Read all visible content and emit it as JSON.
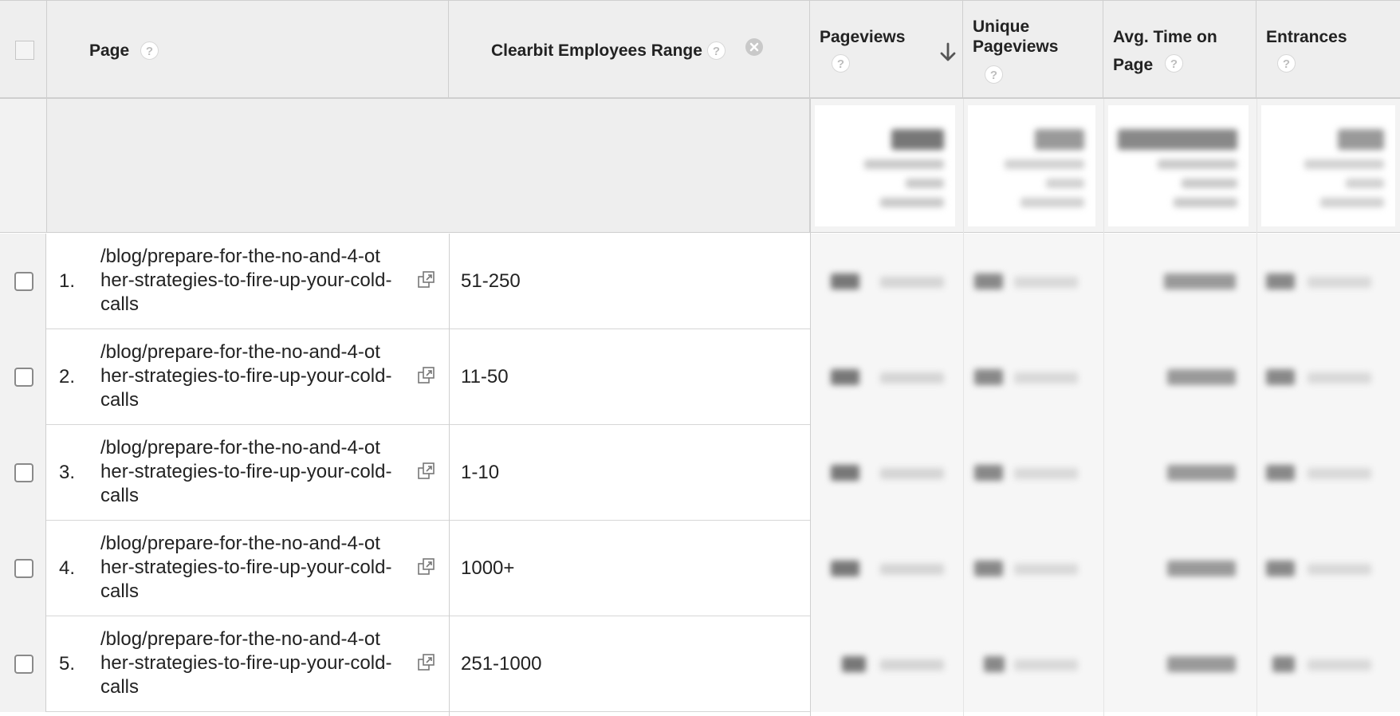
{
  "header": {
    "page_label": "Page",
    "clearbit_label": "Clearbit Employees Range",
    "pageviews_label": "Pageviews",
    "unique_line1": "Unique",
    "unique_line2": "Pageviews",
    "avgtime_line1": "Avg. Time on",
    "avgtime_line2": "Page",
    "entrances_label": "Entrances",
    "help_glyph": "?",
    "sort": "descending"
  },
  "rows": [
    {
      "num": "1.",
      "line1": "/blog/prepare-for-the-no-and-4-ot",
      "line2": "her-strategies-to-fire-up-your-cold-",
      "line3": "calls",
      "range": "51-250"
    },
    {
      "num": "2.",
      "line1": "/blog/prepare-for-the-no-and-4-ot",
      "line2": "her-strategies-to-fire-up-your-cold-",
      "line3": "calls",
      "range": "11-50"
    },
    {
      "num": "3.",
      "line1": "/blog/prepare-for-the-no-and-4-ot",
      "line2": "her-strategies-to-fire-up-your-cold-",
      "line3": "calls",
      "range": "1-10"
    },
    {
      "num": "4.",
      "line1": "/blog/prepare-for-the-no-and-4-ot",
      "line2": "her-strategies-to-fire-up-your-cold-",
      "line3": "calls",
      "range": "1000+"
    },
    {
      "num": "5.",
      "line1": "/blog/prepare-for-the-no-and-4-ot",
      "line2": "her-strategies-to-fire-up-your-cold-",
      "line3": "calls",
      "range": "251-1000"
    }
  ],
  "colors": {
    "header_bg": "#eeeeee",
    "border": "#cfcfcf",
    "text": "#222222"
  }
}
